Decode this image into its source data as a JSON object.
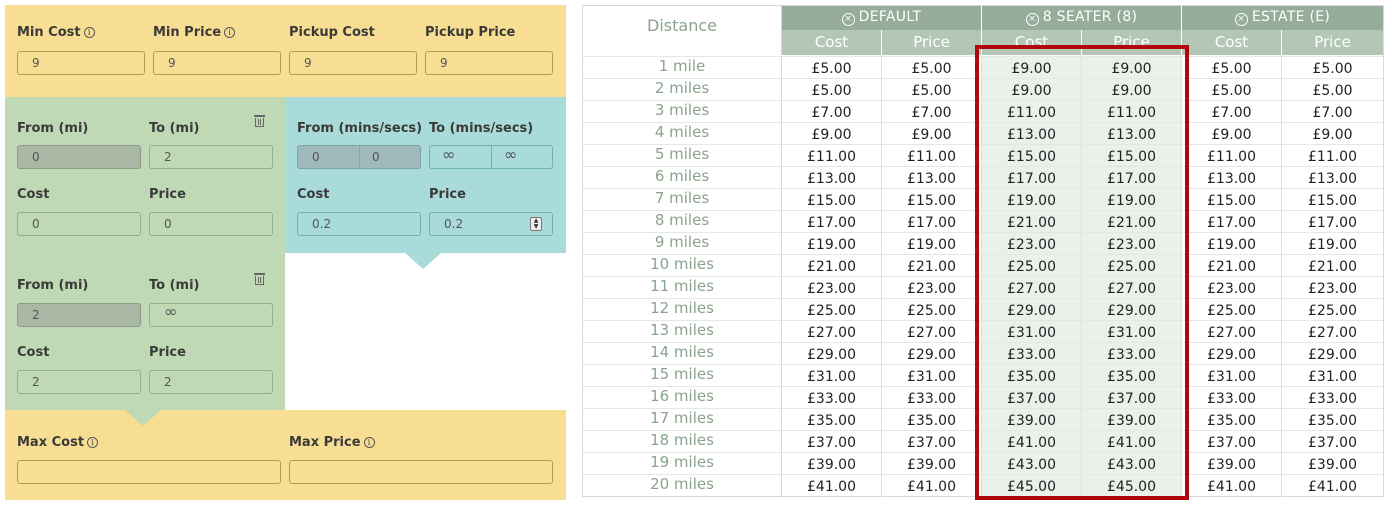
{
  "top": {
    "min_cost_label": "Min Cost",
    "min_cost_value": "9",
    "min_price_label": "Min Price",
    "min_price_value": "9",
    "pickup_cost_label": "Pickup Cost",
    "pickup_cost_value": "9",
    "pickup_price_label": "Pickup Price",
    "pickup_price_value": "9",
    "info_glyph": "i"
  },
  "band1": {
    "from_label": "From (mi)",
    "from_value": "0",
    "to_label": "To (mi)",
    "to_value": "2",
    "cost_label": "Cost",
    "cost_value": "0",
    "price_label": "Price",
    "price_value": "0"
  },
  "time_band": {
    "from_label": "From (mins/secs)",
    "from_mins": "0",
    "from_secs": "0",
    "to_label": "To (mins/secs)",
    "to_mins": "∞",
    "to_secs": "∞",
    "cost_label": "Cost",
    "cost_value": "0.2",
    "price_label": "Price",
    "price_value": "0.2",
    "spin_up": "▲",
    "spin_down": "▼"
  },
  "band2": {
    "from_label": "From (mi)",
    "from_value": "2",
    "to_label": "To (mi)",
    "to_value": "∞",
    "cost_label": "Cost",
    "cost_value": "2",
    "price_label": "Price",
    "price_value": "2"
  },
  "bottom": {
    "max_cost_label": "Max Cost",
    "max_cost_value": "",
    "max_price_label": "Max Price",
    "max_price_value": ""
  },
  "table": {
    "distance_header": "Distance",
    "groups": [
      {
        "name": "DEFAULT",
        "icon": "circle-x-icon"
      },
      {
        "name": "8 SEATER (8)",
        "icon": "circle-x-icon"
      },
      {
        "name": "ESTATE (E)",
        "icon": "circle-x-icon"
      }
    ],
    "sub_cost": "Cost",
    "sub_price": "Price",
    "remove_glyph": "×",
    "rows": [
      {
        "d": "1 mile",
        "v": [
          "£5.00",
          "£5.00",
          "£9.00",
          "£9.00",
          "£5.00",
          "£5.00"
        ]
      },
      {
        "d": "2 miles",
        "v": [
          "£5.00",
          "£5.00",
          "£9.00",
          "£9.00",
          "£5.00",
          "£5.00"
        ]
      },
      {
        "d": "3 miles",
        "v": [
          "£7.00",
          "£7.00",
          "£11.00",
          "£11.00",
          "£7.00",
          "£7.00"
        ]
      },
      {
        "d": "4 miles",
        "v": [
          "£9.00",
          "£9.00",
          "£13.00",
          "£13.00",
          "£9.00",
          "£9.00"
        ]
      },
      {
        "d": "5 miles",
        "v": [
          "£11.00",
          "£11.00",
          "£15.00",
          "£15.00",
          "£11.00",
          "£11.00"
        ]
      },
      {
        "d": "6 miles",
        "v": [
          "£13.00",
          "£13.00",
          "£17.00",
          "£17.00",
          "£13.00",
          "£13.00"
        ]
      },
      {
        "d": "7 miles",
        "v": [
          "£15.00",
          "£15.00",
          "£19.00",
          "£19.00",
          "£15.00",
          "£15.00"
        ]
      },
      {
        "d": "8 miles",
        "v": [
          "£17.00",
          "£17.00",
          "£21.00",
          "£21.00",
          "£17.00",
          "£17.00"
        ]
      },
      {
        "d": "9 miles",
        "v": [
          "£19.00",
          "£19.00",
          "£23.00",
          "£23.00",
          "£19.00",
          "£19.00"
        ]
      },
      {
        "d": "10 miles",
        "v": [
          "£21.00",
          "£21.00",
          "£25.00",
          "£25.00",
          "£21.00",
          "£21.00"
        ]
      },
      {
        "d": "11 miles",
        "v": [
          "£23.00",
          "£23.00",
          "£27.00",
          "£27.00",
          "£23.00",
          "£23.00"
        ]
      },
      {
        "d": "12 miles",
        "v": [
          "£25.00",
          "£25.00",
          "£29.00",
          "£29.00",
          "£25.00",
          "£25.00"
        ]
      },
      {
        "d": "13 miles",
        "v": [
          "£27.00",
          "£27.00",
          "£31.00",
          "£31.00",
          "£27.00",
          "£27.00"
        ]
      },
      {
        "d": "14 miles",
        "v": [
          "£29.00",
          "£29.00",
          "£33.00",
          "£33.00",
          "£29.00",
          "£29.00"
        ]
      },
      {
        "d": "15 miles",
        "v": [
          "£31.00",
          "£31.00",
          "£35.00",
          "£35.00",
          "£31.00",
          "£31.00"
        ]
      },
      {
        "d": "16 miles",
        "v": [
          "£33.00",
          "£33.00",
          "£37.00",
          "£37.00",
          "£33.00",
          "£33.00"
        ]
      },
      {
        "d": "17 miles",
        "v": [
          "£35.00",
          "£35.00",
          "£39.00",
          "£39.00",
          "£35.00",
          "£35.00"
        ]
      },
      {
        "d": "18 miles",
        "v": [
          "£37.00",
          "£37.00",
          "£41.00",
          "£41.00",
          "£37.00",
          "£37.00"
        ]
      },
      {
        "d": "19 miles",
        "v": [
          "£39.00",
          "£39.00",
          "£43.00",
          "£43.00",
          "£39.00",
          "£39.00"
        ]
      },
      {
        "d": "20 miles",
        "v": [
          "£41.00",
          "£41.00",
          "£45.00",
          "£45.00",
          "£41.00",
          "£41.00"
        ]
      }
    ]
  },
  "colors": {
    "highlight_box": "#b2060f",
    "header_group": "#95ad9a",
    "header_sub": "#b4c7b7",
    "yellow_panel": "#f8de93",
    "green_panel": "#bfd9b4",
    "teal_panel": "#a8dbd9"
  }
}
